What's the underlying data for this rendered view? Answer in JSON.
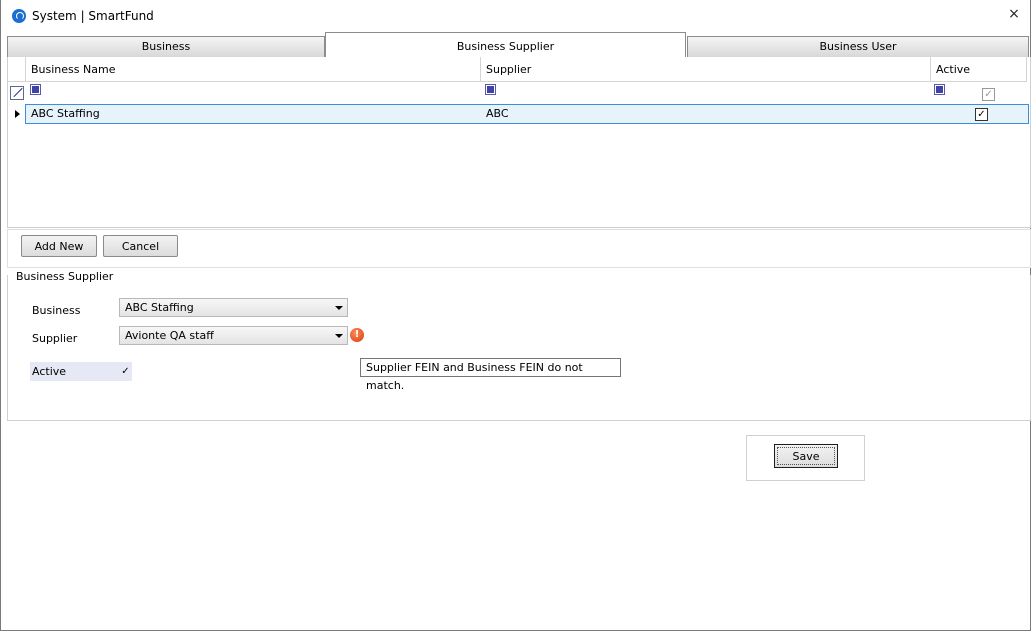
{
  "window": {
    "title": "System | SmartFund",
    "close_glyph": "×"
  },
  "tabs": [
    {
      "label": "Business",
      "active": false
    },
    {
      "label": "Business Supplier",
      "active": true
    },
    {
      "label": "Business User",
      "active": false
    }
  ],
  "grid": {
    "columns": [
      "Business Name",
      "Supplier",
      "Active"
    ],
    "rows": [
      {
        "business_name": "ABC Staffing",
        "supplier": "ABC",
        "active": true
      }
    ]
  },
  "actions": {
    "add_new": "Add New",
    "cancel": "Cancel"
  },
  "form": {
    "group_title": "Business Supplier",
    "business_label": "Business",
    "business_value": "ABC Staffing",
    "supplier_label": "Supplier",
    "supplier_value": "Avionte QA staff",
    "active_label": "Active",
    "active_checked": true,
    "error_icon_glyph": "!",
    "error_message": "Supplier FEIN and Business FEIN do not match."
  },
  "footer": {
    "save": "Save"
  },
  "colors": {
    "selection": "#e6f3fb",
    "selection_border": "#3c8ed8",
    "error": "#d53c0c",
    "app_icon": "#1a6fd1"
  },
  "icons": [
    "app-icon",
    "close-icon",
    "filter-edit-icon",
    "row-pointer-icon",
    "error-icon",
    "dropdown-arrow-icon"
  ]
}
